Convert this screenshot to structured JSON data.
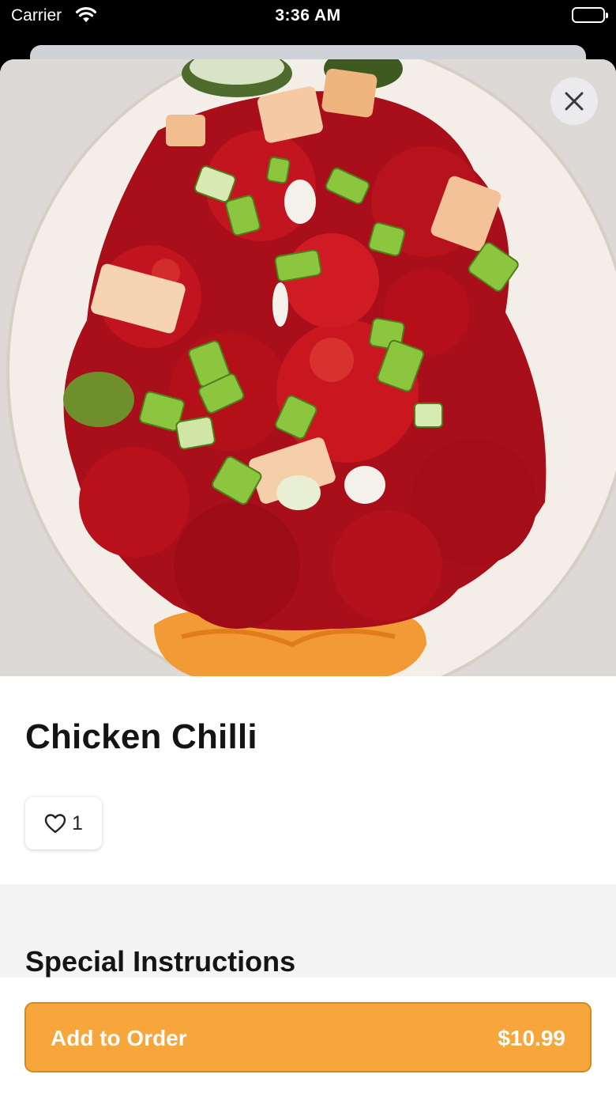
{
  "status_bar": {
    "carrier": "Carrier",
    "time": "3:36 AM"
  },
  "item": {
    "name": "Chicken Chilli",
    "like_count": "1",
    "photo_icon": "food-photo"
  },
  "sections": {
    "special_instructions": "Special Instructions"
  },
  "footer": {
    "add_label": "Add to Order",
    "price": "$10.99"
  },
  "colors": {
    "accent": "#f6a63b",
    "accent_border": "#d9871f",
    "sauce": "#b5121b",
    "scallion": "#7bbf3a"
  }
}
